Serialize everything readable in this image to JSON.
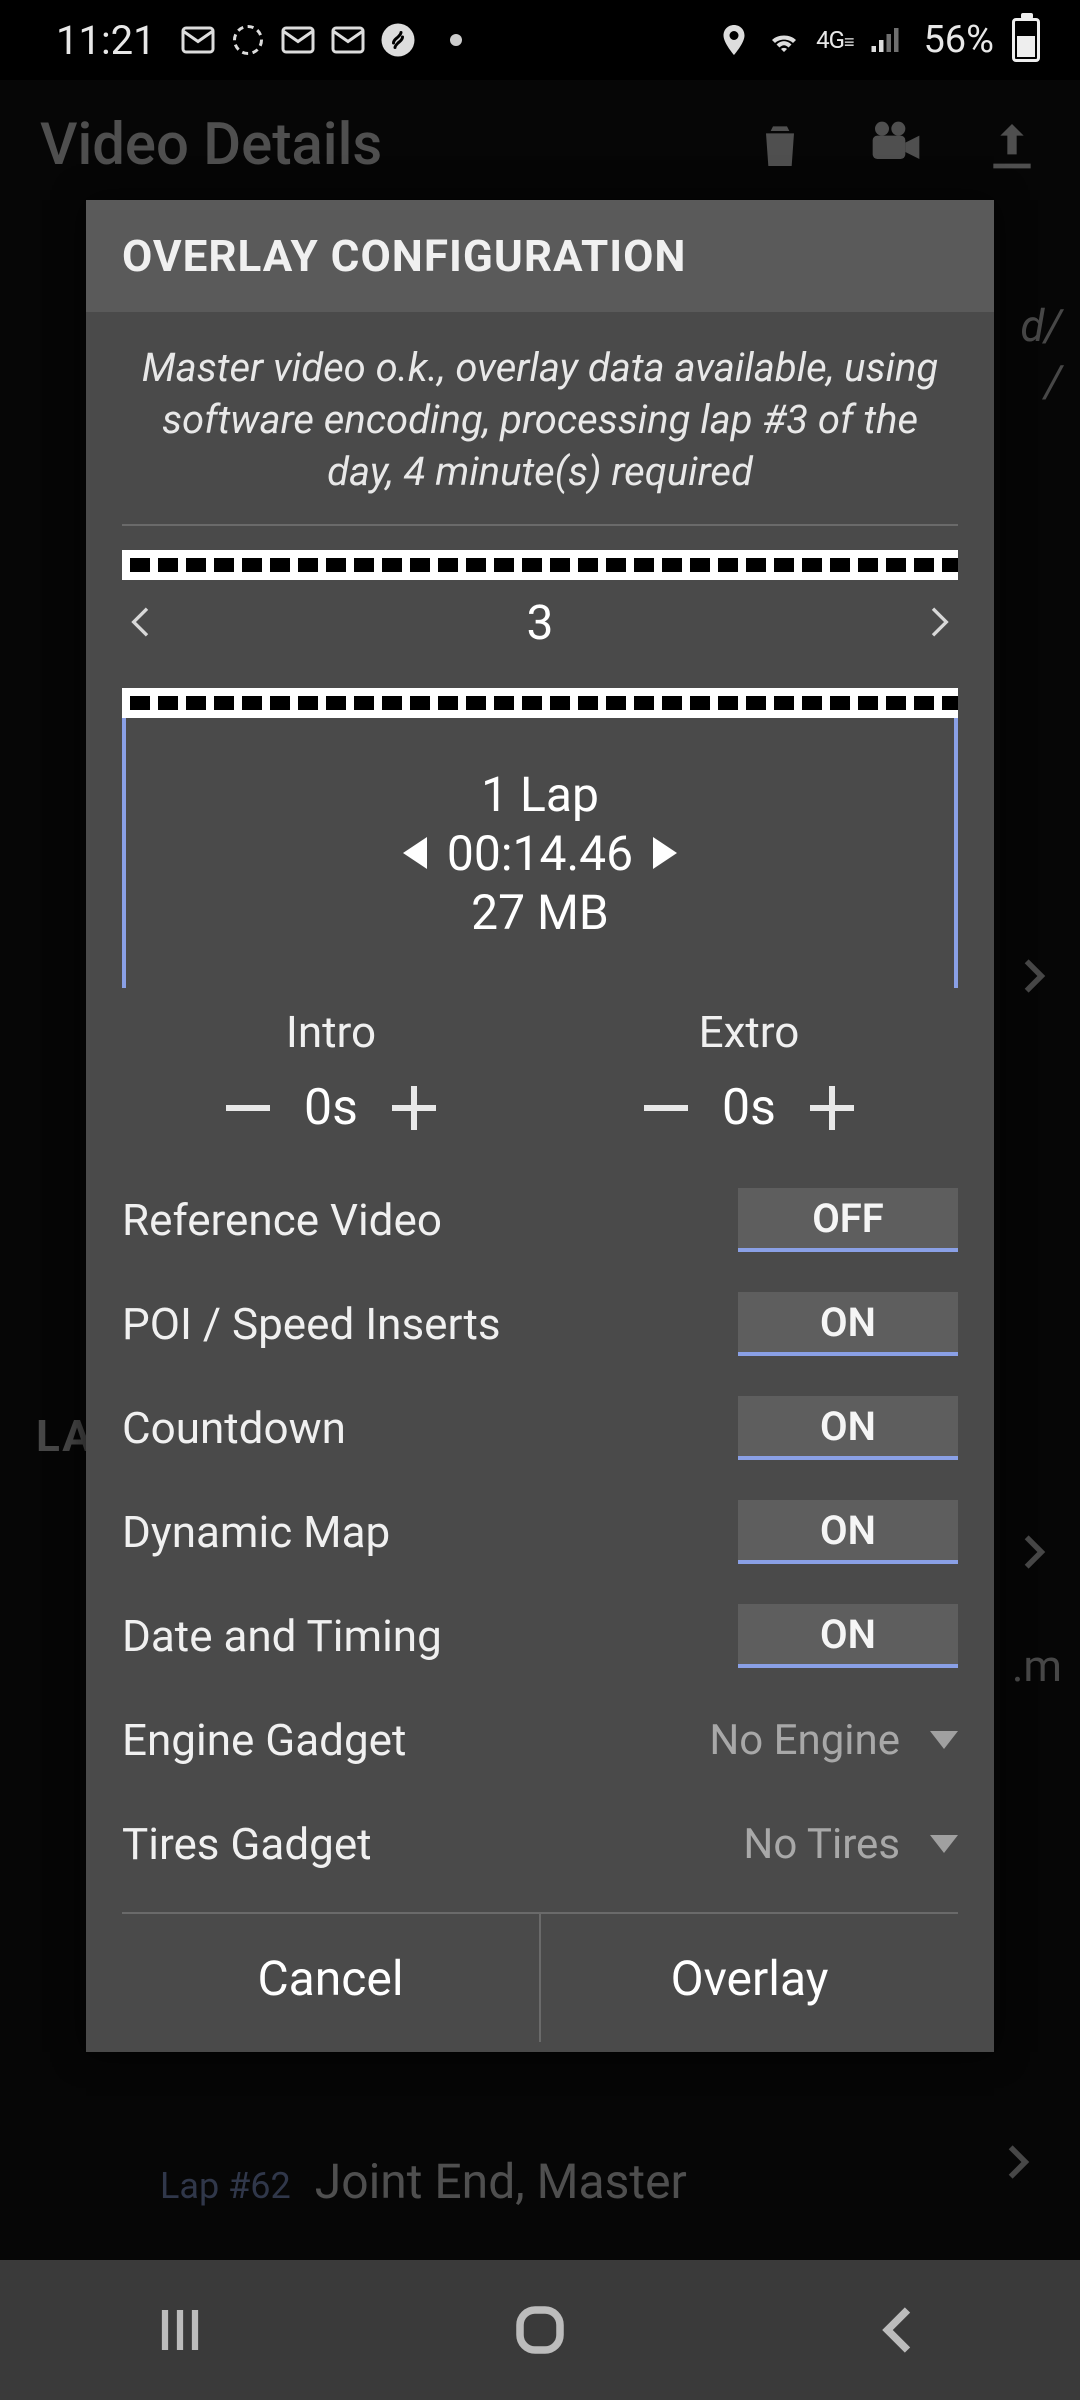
{
  "status": {
    "time": "11:21",
    "battery": "56%",
    "net": "4G"
  },
  "page": {
    "title": "Video Details",
    "bg_lap_label": "Lap #62",
    "bg_lap_text": "Joint End, Master",
    "bg_side_label": "LA",
    "bg_d": "d/",
    "bg_slash": "/",
    "bg_m": ".m"
  },
  "dialog": {
    "title": "OVERLAY CONFIGURATION",
    "status_msg": "Master video o.k., overlay data available, using software encoding, processing lap #3 of the day, 4 minute(s) required",
    "lap_number": "3",
    "clip": {
      "laps": "1 Lap",
      "time": "00:14.46",
      "size": "27 MB"
    },
    "intro": {
      "label": "Intro",
      "value": "0s"
    },
    "extro": {
      "label": "Extro",
      "value": "0s"
    },
    "options": [
      {
        "label": "Reference Video",
        "value": "OFF",
        "type": "toggle"
      },
      {
        "label": "POI / Speed Inserts",
        "value": "ON",
        "type": "toggle"
      },
      {
        "label": "Countdown",
        "value": "ON",
        "type": "toggle"
      },
      {
        "label": "Dynamic Map",
        "value": "ON",
        "type": "toggle"
      },
      {
        "label": "Date and Timing",
        "value": "ON",
        "type": "toggle"
      },
      {
        "label": "Engine Gadget",
        "value": "No Engine",
        "type": "select"
      },
      {
        "label": "Tires Gadget",
        "value": "No Tires",
        "type": "select"
      }
    ],
    "buttons": {
      "cancel": "Cancel",
      "confirm": "Overlay"
    }
  }
}
